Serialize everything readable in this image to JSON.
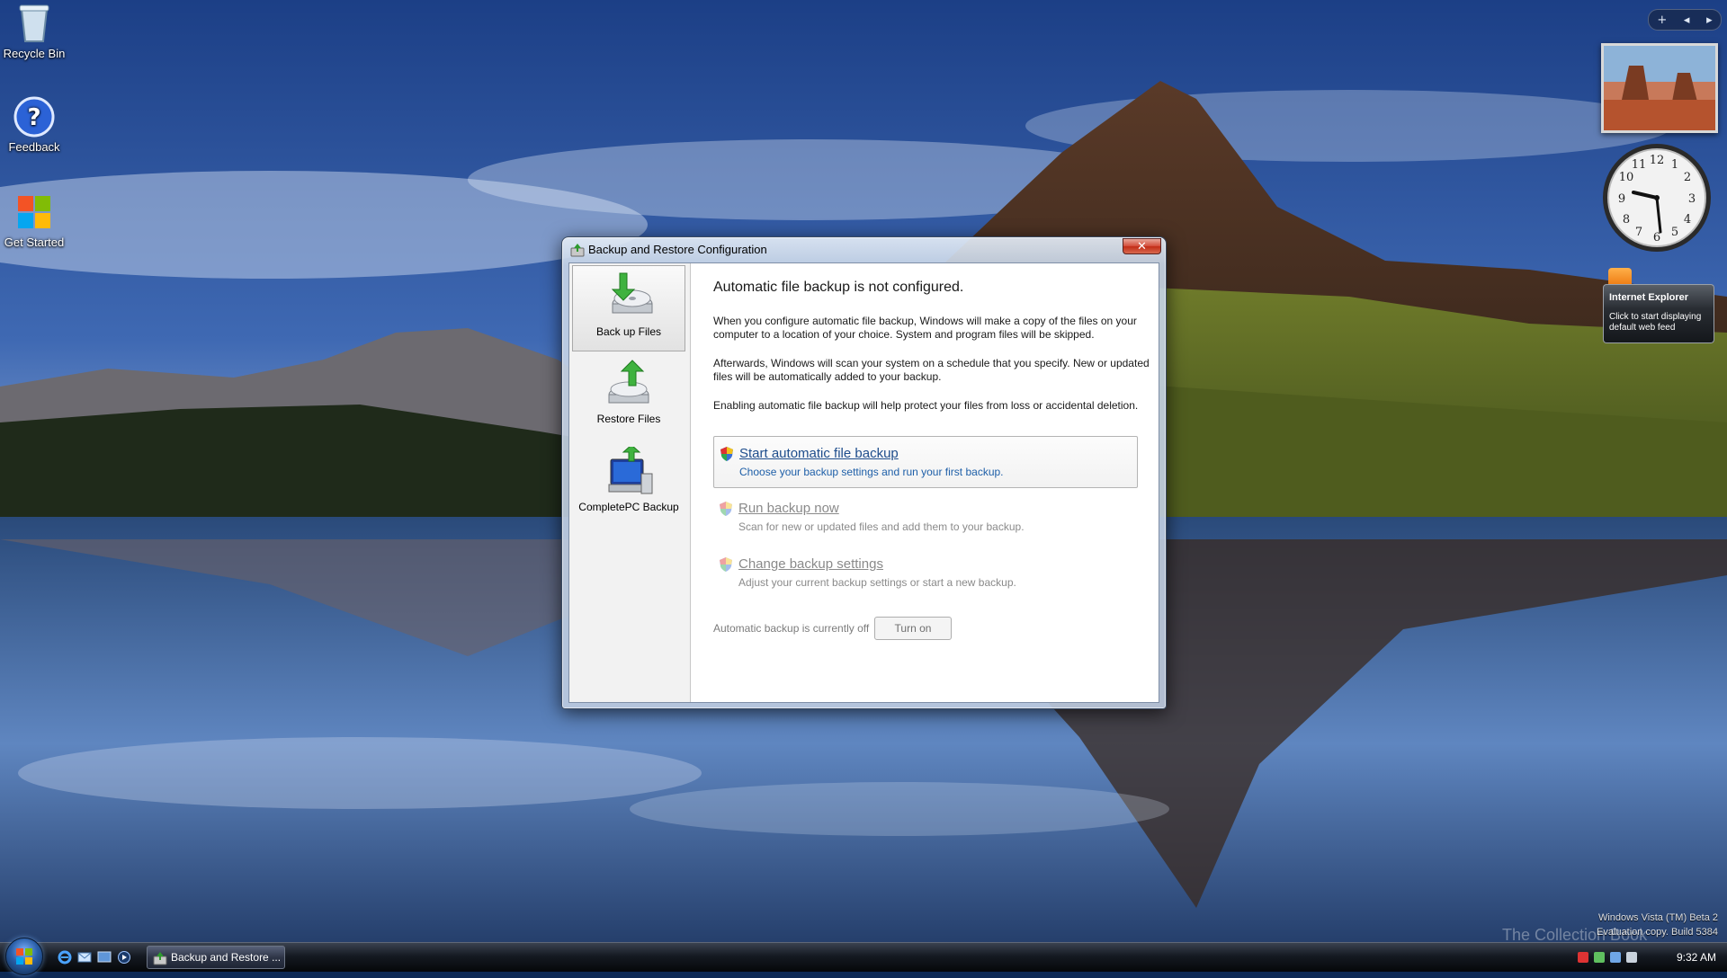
{
  "desktop": {
    "icons": [
      {
        "label": "Recycle Bin",
        "icon": "recycle-bin-icon"
      },
      {
        "label": "Feedback",
        "icon": "feedback-icon"
      },
      {
        "label": "Get Started",
        "icon": "windows-logo-icon"
      }
    ]
  },
  "sidebar": {
    "controls": {
      "add": "+",
      "prev": "◂",
      "next": "▸"
    },
    "feed_gadget": {
      "title": "Internet Explorer",
      "body": "Click to start displaying default web feed"
    }
  },
  "window": {
    "title": "Backup and Restore Configuration",
    "close_glyph": "✕",
    "nav": [
      {
        "label": "Back up Files",
        "selected": true,
        "icon": "backup-files-icon"
      },
      {
        "label": "Restore Files",
        "selected": false,
        "icon": "restore-files-icon"
      },
      {
        "label": "CompletePC Backup",
        "selected": false,
        "icon": "completepc-backup-icon"
      }
    ],
    "heading": "Automatic file backup is not configured.",
    "paragraphs": [
      "When you configure automatic file backup, Windows will make a copy of the files on your computer to a location of your choice. System and program files will be skipped.",
      "Afterwards, Windows will scan your system on a schedule that you specify. New or updated files will be automatically added to your backup.",
      "Enabling automatic file backup will help protect your files from loss or accidental deletion."
    ],
    "tasks": [
      {
        "title": "Start automatic file backup",
        "desc": "Choose your backup settings and run your first backup.",
        "enabled": true
      },
      {
        "title": "Run backup now",
        "desc": "Scan for new or updated files and add them to your backup.",
        "enabled": false
      },
      {
        "title": "Change backup settings",
        "desc": "Adjust your current backup settings or start a new backup.",
        "enabled": false
      }
    ],
    "status_text": "Automatic backup is currently off",
    "turn_on_label": "Turn on"
  },
  "taskbar": {
    "active_task": "Backup and Restore ...",
    "time": "9:32 AM"
  },
  "watermark": {
    "line1": "Windows Vista (TM) Beta 2",
    "line2": "Evaluation copy. Build 5384",
    "brand": "The Collection Book"
  },
  "colors": {
    "link_blue": "#1e4d8c",
    "disabled_gray": "#8a8a8a",
    "close_red": "#c22c16"
  }
}
